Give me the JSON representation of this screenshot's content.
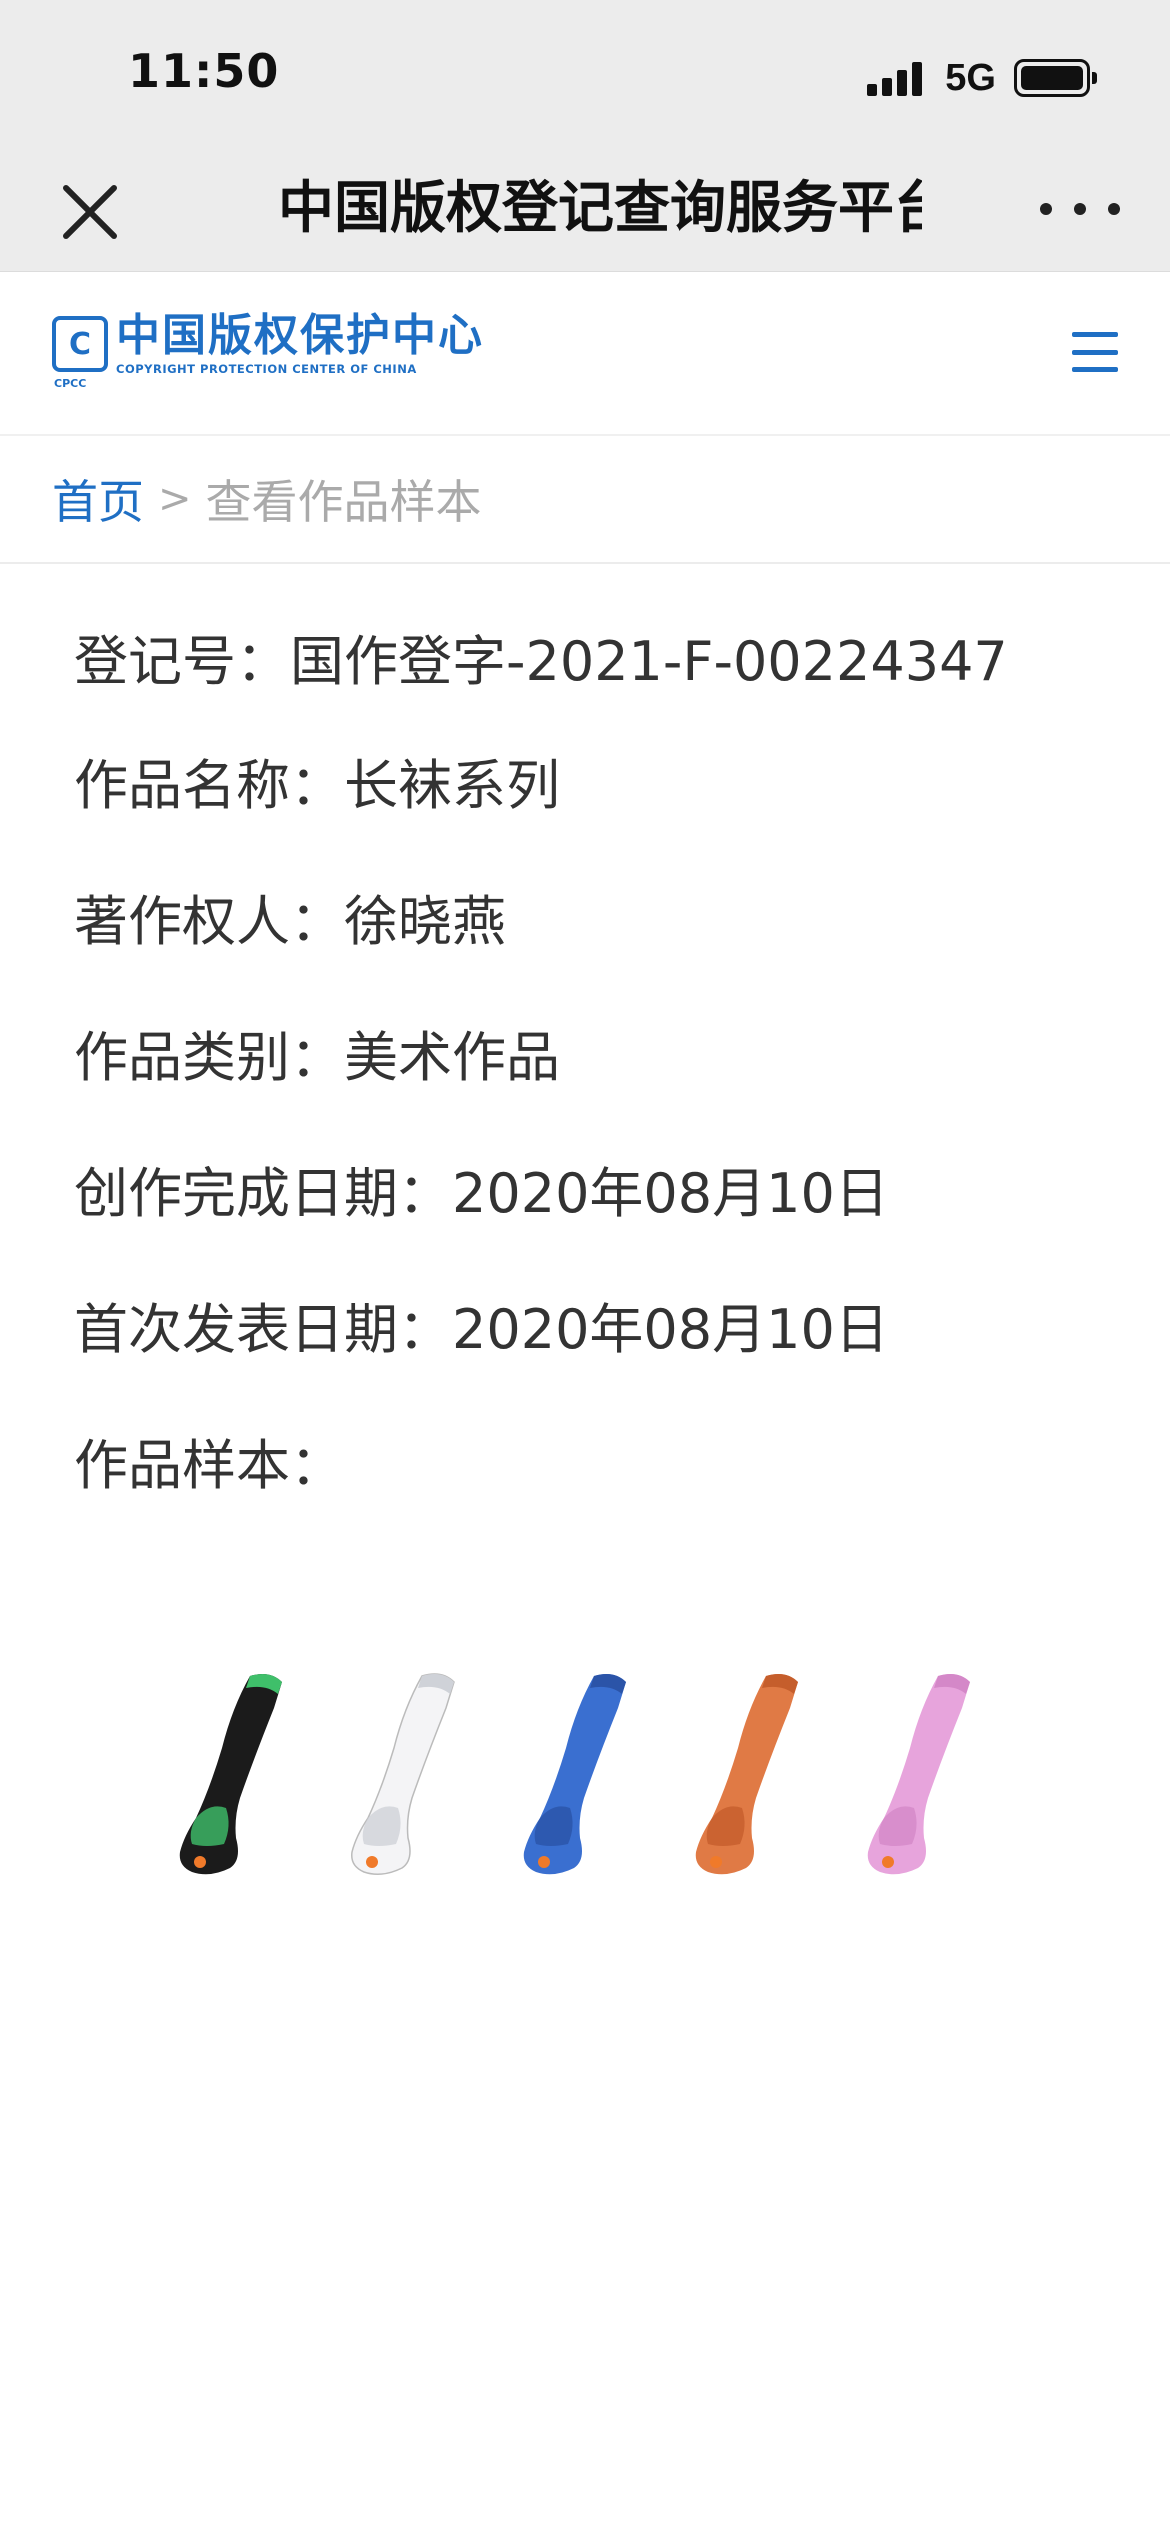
{
  "status": {
    "time": "11:50",
    "network": "5G"
  },
  "nav": {
    "title": "中国版权登记查询服务平台"
  },
  "site": {
    "logo_mark": "C",
    "logo_abbr": "CPCC",
    "logo_cn": "中国版权保护中心",
    "logo_en": "COPYRIGHT PROTECTION CENTER OF CHINA"
  },
  "breadcrumb": {
    "home": "首页",
    "separator": ">",
    "current": "查看作品样本"
  },
  "record": {
    "reg_label": "登记号：",
    "reg_value": "国作登字-2021-F-00224347",
    "name_label": "作品名称：",
    "name_value": "长袜系列",
    "owner_label": "著作权人：",
    "owner_value": "徐晓燕",
    "category_label": "作品类别：",
    "category_value": "美术作品",
    "created_label": "创作完成日期：",
    "created_value": "2020年08月10日",
    "published_label": "首次发表日期：",
    "published_value": "2020年08月10日",
    "sample_label": "作品样本："
  },
  "samples": [
    {
      "name": "black-sock",
      "color": "#1b1b1b",
      "accent": "#3fbf6a"
    },
    {
      "name": "white-sock",
      "color": "#f4f4f6",
      "accent": "#cfd2d8"
    },
    {
      "name": "blue-sock",
      "color": "#3a6fd0",
      "accent": "#2b54a8"
    },
    {
      "name": "orange-sock",
      "color": "#e07a45",
      "accent": "#c55e2c"
    },
    {
      "name": "pink-sock",
      "color": "#e7a4dc",
      "accent": "#d488c8"
    }
  ]
}
